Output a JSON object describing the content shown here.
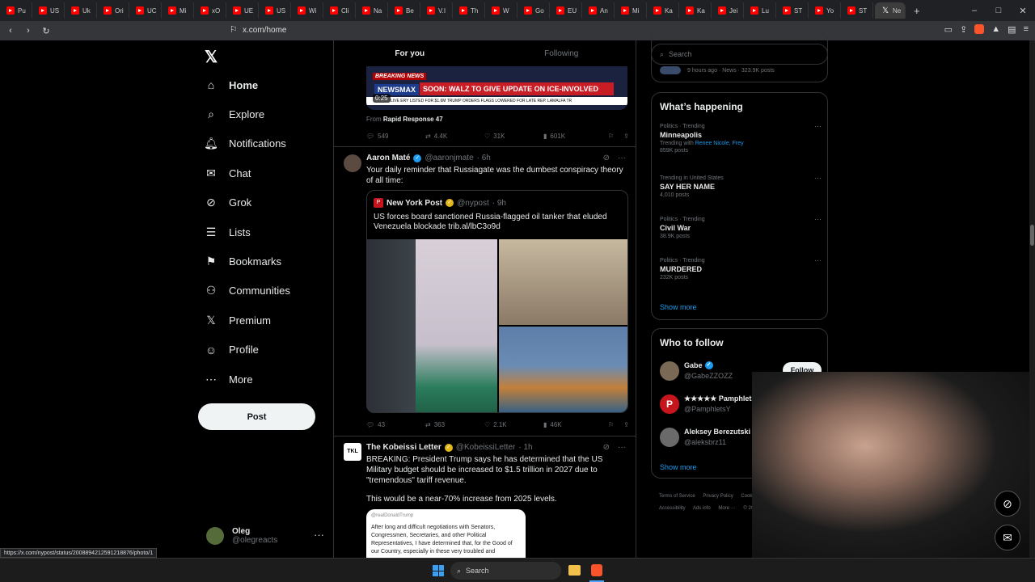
{
  "browser": {
    "tabs": [
      "Pu",
      "US",
      "Uk",
      "Ori",
      "UC",
      "Mi",
      "xO",
      "UE",
      "US",
      "Wi",
      "Cli",
      "Na",
      "Be",
      "V.I",
      "Th",
      "W",
      "Go",
      "EU",
      "An",
      "Mi",
      "Ka",
      "Ka",
      "Jei",
      "Lu",
      "ST",
      "Yo",
      "ST",
      "Ne"
    ],
    "active_tab_icon": "x-logo-icon",
    "url": "x.com/home",
    "window_controls": [
      "–",
      "□",
      "✕"
    ],
    "status_url": "https://x.com/nypost/status/2008894212591218876/photo/1"
  },
  "nav": {
    "logo": "𝕏",
    "items": [
      {
        "label": "Home",
        "icon": "⌂",
        "active": true
      },
      {
        "label": "Explore",
        "icon": "⌕"
      },
      {
        "label": "Notifications",
        "icon": "🔔︎"
      },
      {
        "label": "Chat",
        "icon": "✉"
      },
      {
        "label": "Grok",
        "icon": "⊘"
      },
      {
        "label": "Lists",
        "icon": "☰"
      },
      {
        "label": "Bookmarks",
        "icon": "⚑"
      },
      {
        "label": "Communities",
        "icon": "⚇"
      },
      {
        "label": "Premium",
        "icon": "𝕏"
      },
      {
        "label": "Profile",
        "icon": "☺"
      },
      {
        "label": "More",
        "icon": "⋯"
      }
    ],
    "post_label": "Post",
    "account": {
      "name": "Oleg",
      "handle": "@olegreacts"
    }
  },
  "feed": {
    "tabs": [
      "For you",
      "Following"
    ],
    "video_post": {
      "breaking": "BREAKING NEWS",
      "network": "NEWSMAX",
      "headline": "SOON: WALZ TO GIVE UPDATE ON ICE-INVOLVED SHOOTING",
      "ticker": "LIVE   ERY LISTED FOR $1.6M      TRUMP ORDERS FLAGS LOWERED FOR LATE REP. LAMALFA      TR",
      "duration": "0:25",
      "from_prefix": "From",
      "from_account": "Rapid Response 47",
      "actions": {
        "replies": "549",
        "reposts": "4.4K",
        "likes": "31K",
        "views": "601K"
      }
    },
    "tweet1": {
      "name": "Aaron Maté",
      "handle": "@aaronjmate",
      "time": "· 6h",
      "text": "Your daily reminder that Russiagate was the dumbest conspiracy theory of all time:",
      "quote": {
        "name": "New York Post",
        "handle": "@nypost",
        "time": "· 9h",
        "text": "US forces board sanctioned Russia-flagged oil tanker that eluded Venezuela blockade trib.al/lbC3o9d"
      },
      "actions": {
        "replies": "43",
        "reposts": "363",
        "likes": "2.1K",
        "views": "46K"
      }
    },
    "tweet2": {
      "avatar": "TKL",
      "name": "The Kobeissi Letter",
      "handle": "@KobeissiLetter",
      "time": "· 1h",
      "text": "BREAKING: President Trump says he has determined that the US Military budget should be increased to $1.5 trillion in 2027 due to \"tremendous\" tariff revenue.",
      "text2": "This would be a near-70% increase from 2025 levels.",
      "image_handle": "@realDonaldTrump",
      "image_text": "After long and difficult negotiations with Senators, Congressmen, Secretaries, and other Political Representatives, I have determined that, for the Good of our Country, especially in these very troubled and"
    }
  },
  "sidebar": {
    "search_placeholder": "Search",
    "top_meta": "9 hours ago · News · 323.9K posts",
    "happening_title": "What’s happening",
    "trends": [
      {
        "meta": "Politics · Trending",
        "title": "Minneapolis",
        "with": "Trending with",
        "with_links": "Renee Nicole, Frey",
        "count": "859K posts"
      },
      {
        "meta": "Trending in United States",
        "title": "SAY HER NAME",
        "count": "4,010 posts"
      },
      {
        "meta": "Politics · Trending",
        "title": "Civil War",
        "count": "38.9K posts"
      },
      {
        "meta": "Politics · Trending",
        "title": "MURDERED",
        "count": "232K posts"
      }
    ],
    "show_more": "Show more",
    "wtf_title": "Who to follow",
    "wtf": [
      {
        "name": "Gabe",
        "handle": "@GabeZZOZZ",
        "color": "#7a6a55"
      },
      {
        "name": "★★★★★ Pamphlets ...",
        "handle": "@PamphletsY",
        "color": "#c4161c",
        "letter": "P"
      },
      {
        "name": "Aleksey Berezutski ...",
        "handle": "@aleksbrz11",
        "color": "#6a6a6a"
      }
    ],
    "follow_label": "Follow",
    "footer": [
      "Terms of Service",
      "Privacy Policy",
      "Cookie Policy",
      "Accessibility",
      "Ads info",
      "More ···",
      "© 2026"
    ]
  },
  "taskbar": {
    "search": "Search"
  }
}
